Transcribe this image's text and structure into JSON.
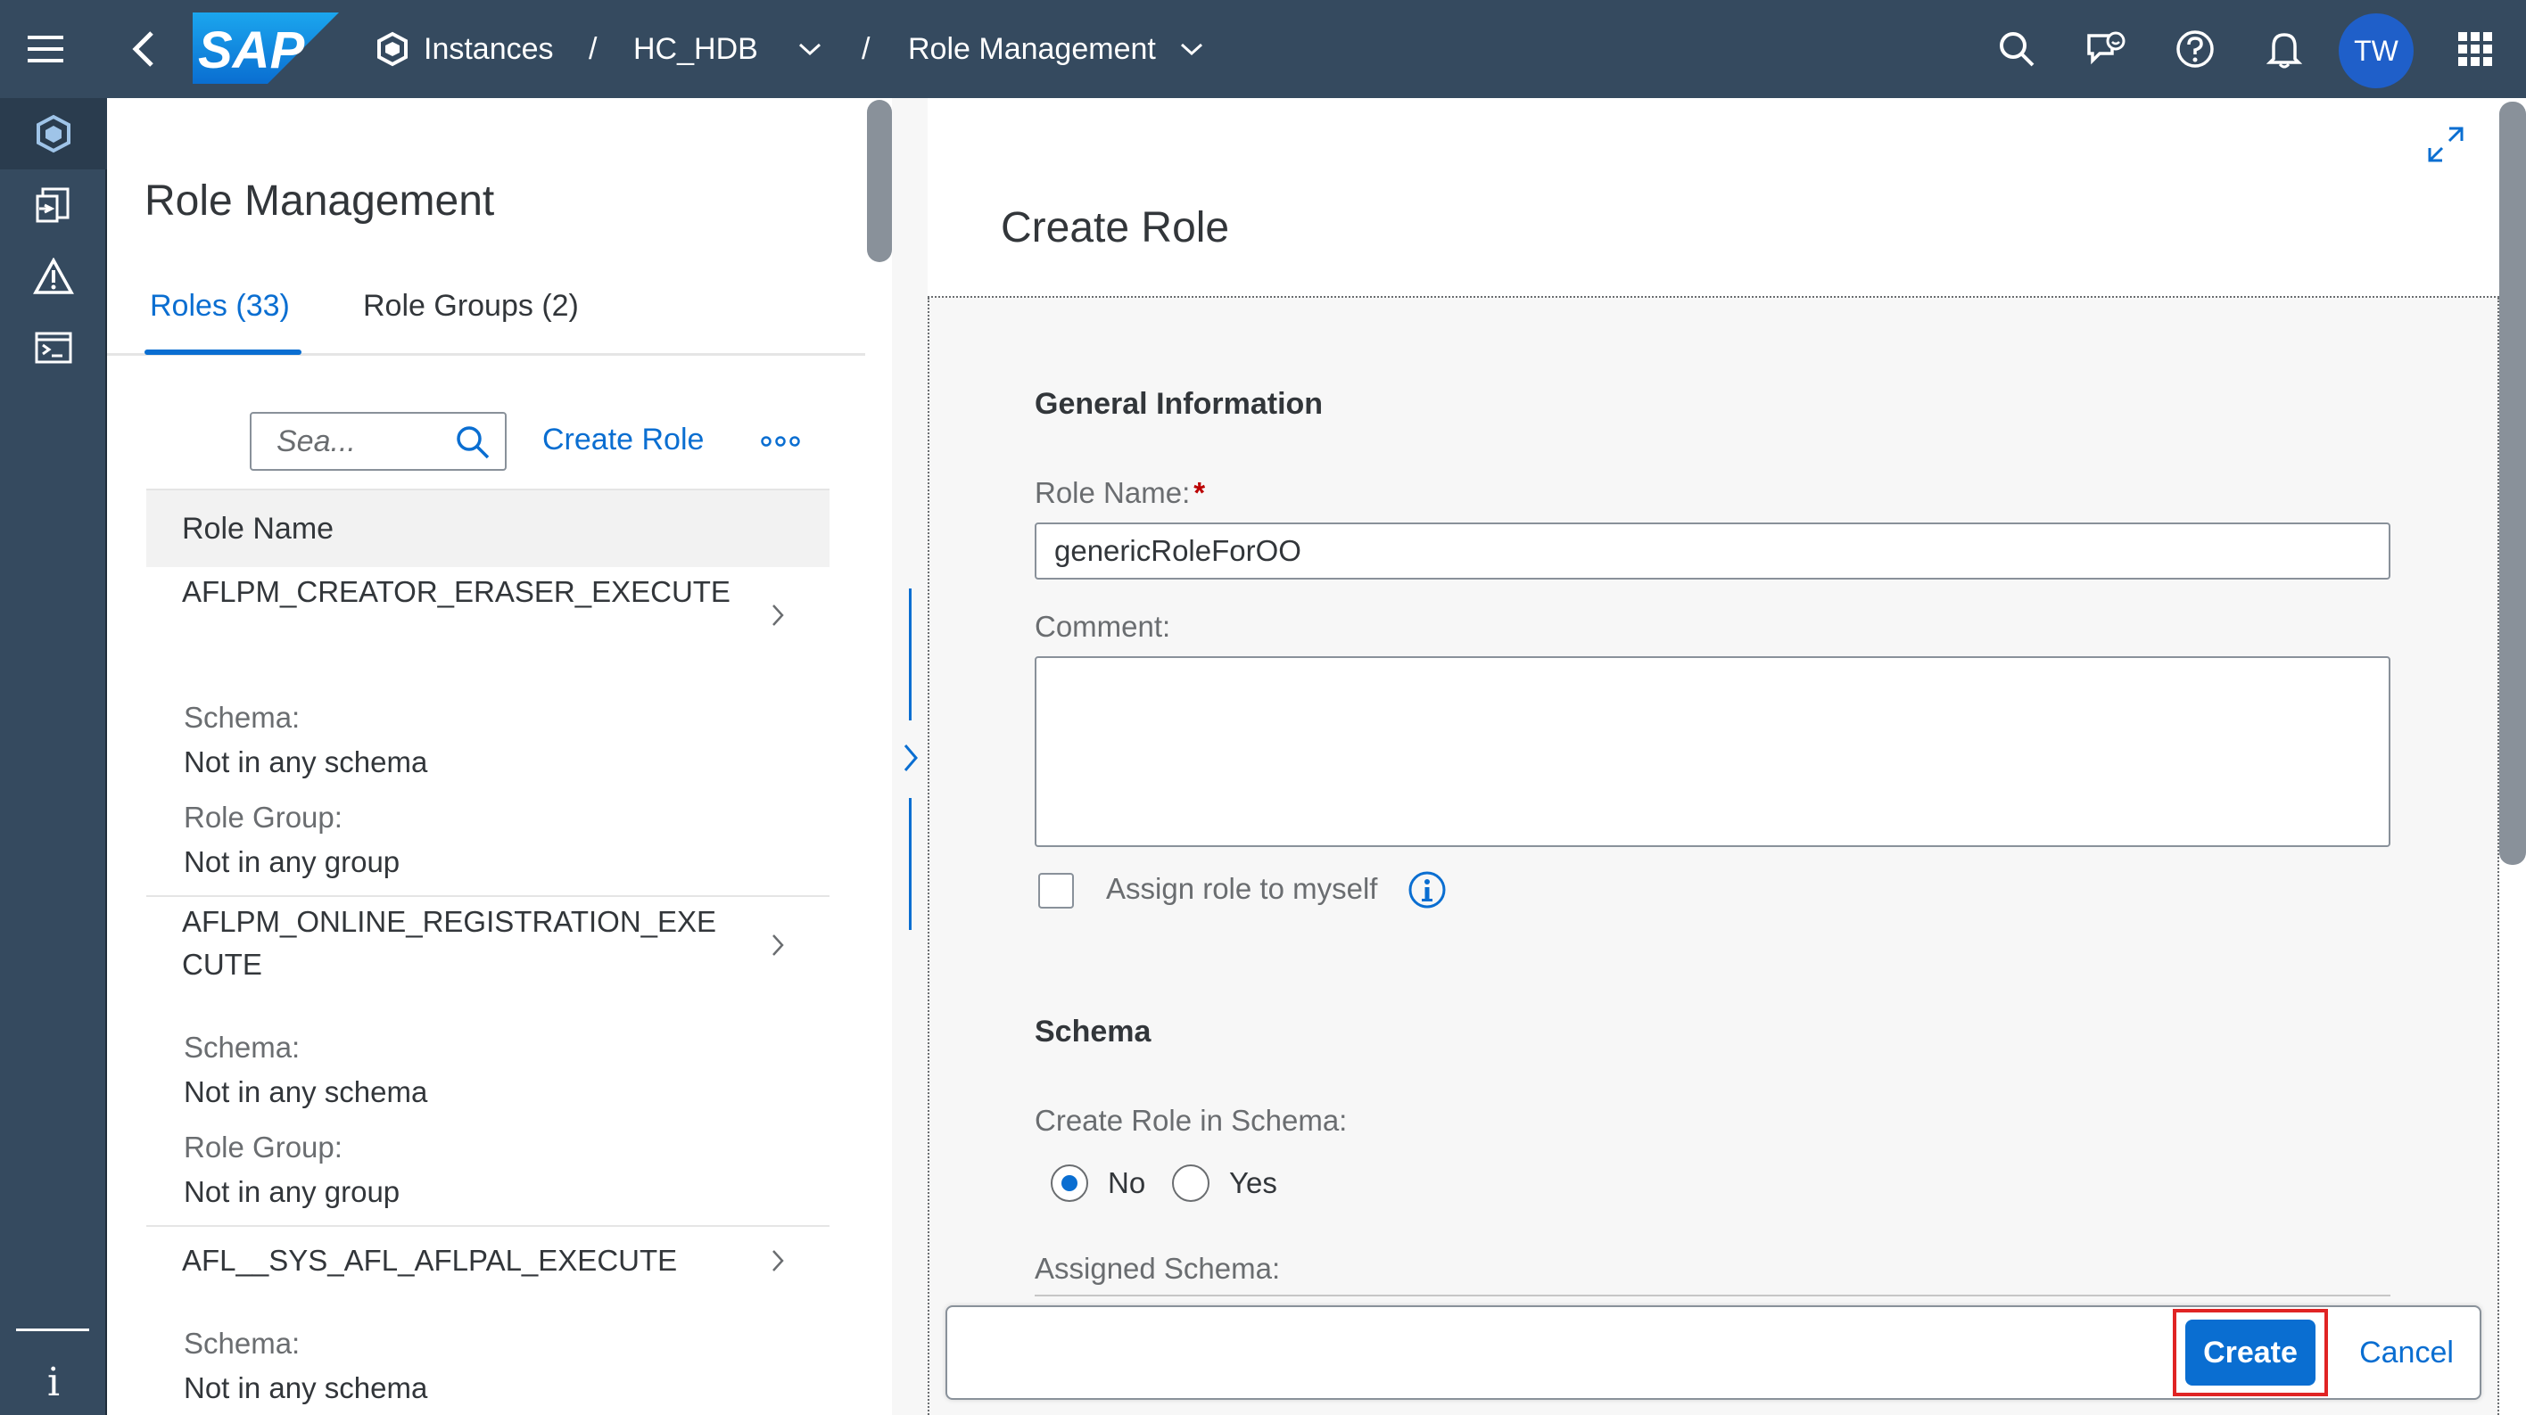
{
  "shell": {
    "logo_text": "SAP",
    "breadcrumbs": [
      {
        "label": "Instances"
      },
      {
        "label": "HC_HDB"
      },
      {
        "label": "Role Management"
      }
    ],
    "separator": "/",
    "avatar_initials": "TW"
  },
  "left_panel": {
    "title": "Role Management",
    "tabs": [
      {
        "label": "Roles (33)",
        "active": true
      },
      {
        "label": "Role Groups (2)",
        "active": false
      }
    ],
    "search_placeholder": "Sea...",
    "create_role_link": "Create Role",
    "list_header": "Role Name",
    "items": [
      {
        "name": "AFLPM_CREATOR_ERASER_EXECUTE",
        "schema_label": "Schema:",
        "schema_value": "Not in any schema",
        "group_label": "Role Group:",
        "group_value": "Not in any group"
      },
      {
        "name": "AFLPM_ONLINE_REGISTRATION_EXECUTE",
        "schema_label": "Schema:",
        "schema_value": "Not in any schema",
        "group_label": "Role Group:",
        "group_value": "Not in any group"
      },
      {
        "name": "AFL__SYS_AFL_AFLPAL_EXECUTE",
        "schema_label": "Schema:",
        "schema_value": "Not in any schema"
      }
    ]
  },
  "right_panel": {
    "title": "Create Role",
    "general_section": "General Information",
    "role_name_label": "Role Name:",
    "required_mark": "*",
    "role_name_value": "genericRoleForOO",
    "comment_label": "Comment:",
    "assign_label": "Assign role to myself",
    "assign_checked": false,
    "schema_section": "Schema",
    "create_in_schema_label": "Create Role in Schema:",
    "radio_options": [
      {
        "label": "No",
        "selected": true
      },
      {
        "label": "Yes",
        "selected": false
      }
    ],
    "assigned_schema_label": "Assigned Schema:"
  },
  "footer": {
    "create_button": "Create",
    "cancel_button": "Cancel"
  },
  "colors": {
    "shell": "#354a5f",
    "accent": "#0a6ed1",
    "highlight": "#e02424"
  }
}
